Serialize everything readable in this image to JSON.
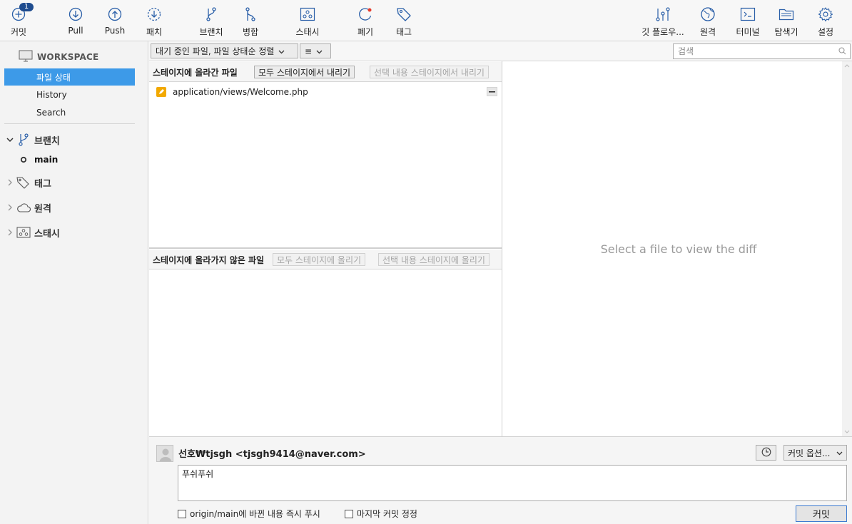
{
  "toolbar": {
    "commit": {
      "label": "커밋",
      "badge": "1",
      "icon": "plus-circle-icon"
    },
    "pull": {
      "label": "Pull",
      "icon": "arrow-down-circle-icon"
    },
    "push": {
      "label": "Push",
      "icon": "arrow-up-circle-icon"
    },
    "fetch": {
      "label": "패치",
      "icon": "fetch-icon"
    },
    "branch": {
      "label": "브랜치",
      "icon": "branch-icon"
    },
    "merge": {
      "label": "병합",
      "icon": "merge-icon"
    },
    "stash": {
      "label": "스태시",
      "icon": "stash-icon"
    },
    "discard": {
      "label": "폐기",
      "icon": "discard-icon"
    },
    "tag": {
      "label": "태그",
      "icon": "tag-icon"
    },
    "gitflow": {
      "label": "깃 플로우...",
      "icon": "git-flow-icon"
    },
    "remote": {
      "label": "원격",
      "icon": "globe-icon"
    },
    "terminal": {
      "label": "터미널",
      "icon": "terminal-icon"
    },
    "explorer": {
      "label": "탐색기",
      "icon": "folder-icon"
    },
    "settings": {
      "label": "설정",
      "icon": "gear-icon"
    }
  },
  "sidebar": {
    "workspace": "WORKSPACE",
    "items": [
      {
        "label": "파일 상태",
        "selected": true
      },
      {
        "label": "History",
        "selected": false
      },
      {
        "label": "Search",
        "selected": false
      }
    ],
    "branches": {
      "label": "브랜치",
      "current": "main"
    },
    "tags": {
      "label": "태그"
    },
    "remotes": {
      "label": "원격"
    },
    "stashes": {
      "label": "스태시"
    }
  },
  "filterbar": {
    "filter_label": "대기 중인 파일, 파일 상태순 정렬",
    "view_label": "≡",
    "search_placeholder": "검색"
  },
  "staged": {
    "title": "스테이지에 올라간 파일",
    "unstage_all": "모두 스테이지에서 내리기",
    "unstage_selected": "선택 내용 스테이지에서 내리기",
    "files": [
      {
        "name": "application/views/Welcome.php",
        "status": "modified"
      }
    ]
  },
  "unstaged": {
    "title": "스테이지에 올라가지 않은 파일",
    "stage_all": "모두 스테이지에 올리기",
    "stage_selected": "선택 내용 스테이지에 올리기"
  },
  "diff": {
    "placeholder": "Select a file to view the diff"
  },
  "commit": {
    "author": "선호₩tjsgh <tjsgh9414@naver.com>",
    "options_label": "커밋 옵션...",
    "message": "푸쉬푸쉬",
    "push_checkbox": "origin/main에 바뀐 내용 즉시 푸시",
    "amend_checkbox": "마지막 커밋 정정",
    "commit_button": "커밋"
  },
  "colors": {
    "selection": "#3d9ae8",
    "icon_blue": "#2a5fa8",
    "modified": "#f2a900",
    "badge": "#1f4c8f"
  }
}
